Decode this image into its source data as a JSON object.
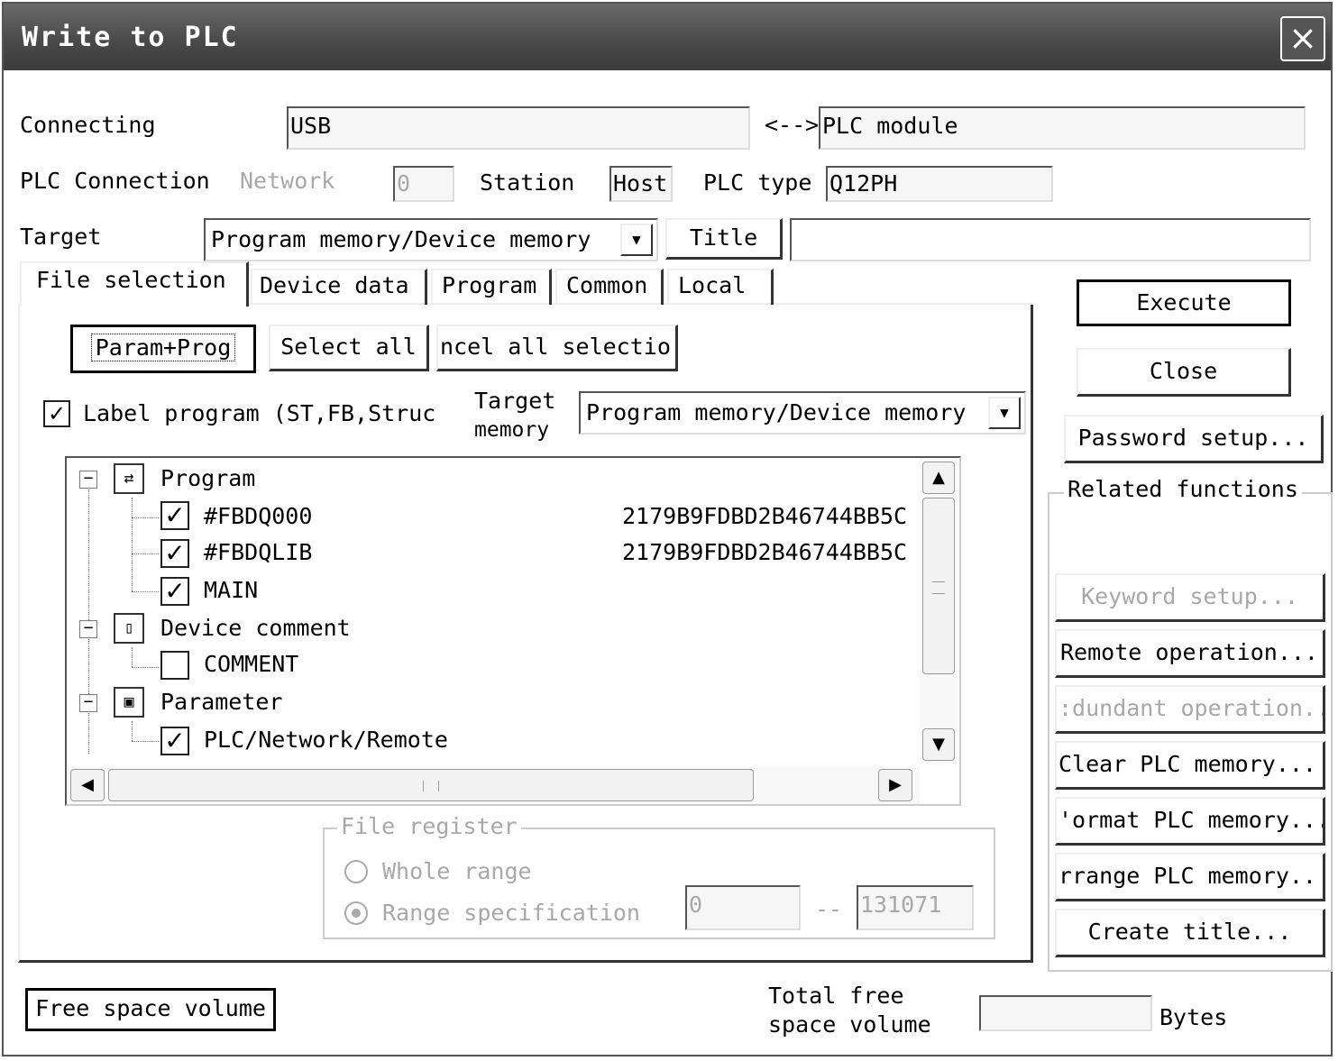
{
  "window": {
    "title": "Write to PLC",
    "close_glyph": "×"
  },
  "connection": {
    "connecting_label": "Connecting",
    "connecting_value": "USB",
    "arrow": "<-->",
    "module_value": "PLC module",
    "plc_connection_label": "PLC Connection",
    "network_label": "Network",
    "network_value": "0",
    "station_label": "Station",
    "station_value": "Host",
    "plc_type_label": "PLC type",
    "plc_type_value": "Q12PH"
  },
  "target": {
    "label": "Target",
    "selected": "Program memory/Device memory",
    "title_button": "Title",
    "title_value": ""
  },
  "tabs": [
    {
      "label": "File selection",
      "active": true
    },
    {
      "label": "Device data"
    },
    {
      "label": "Program"
    },
    {
      "label": "Common"
    },
    {
      "label": "Local"
    }
  ],
  "file_selection": {
    "param_prog_button": "Param+Prog",
    "select_all_button": "Select all",
    "cancel_all_button": "ncel all selectio",
    "label_program_checkbox": "Label program (ST,FB,Struc",
    "label_program_checked": true,
    "target_memory_label_1": "Target",
    "target_memory_label_2": "memory",
    "target_memory_selected": "Program memory/Device memory"
  },
  "tree": {
    "groups": [
      {
        "label": "Program",
        "icon": "program-icon",
        "expander": "−",
        "items": [
          {
            "label": "#FBDQ000",
            "checked": true,
            "hash": "2179B9FDBD2B46744BB5C"
          },
          {
            "label": "#FBDQLIB",
            "checked": true,
            "hash": "2179B9FDBD2B46744BB5C"
          },
          {
            "label": "MAIN",
            "checked": true,
            "hash": ""
          }
        ]
      },
      {
        "label": "Device comment",
        "icon": "device-comment-icon",
        "expander": "−",
        "items": [
          {
            "label": "COMMENT",
            "checked": false,
            "hash": ""
          }
        ]
      },
      {
        "label": "Parameter",
        "icon": "parameter-icon",
        "expander": "−",
        "items": [
          {
            "label": "PLC/Network/Remote",
            "checked": true,
            "hash": ""
          }
        ]
      }
    ]
  },
  "file_register": {
    "group_label": "File register",
    "whole_range": "Whole range",
    "range_spec": "Range specification",
    "range_from": "0",
    "range_sep": "--",
    "range_to": "131071",
    "selected": "range_spec"
  },
  "actions": {
    "execute": "Execute",
    "close": "Close",
    "password_setup": "Password setup...",
    "related_label": "Related functions",
    "keyword_setup": "Keyword setup...",
    "remote_operation": "Remote operation...",
    "redundant_operation": ":dundant operation...",
    "clear_memory": "Clear PLC memory...",
    "format_memory": "'ormat PLC memory...",
    "arrange_memory": "rrange PLC memory..",
    "create_title": "Create title..."
  },
  "footer": {
    "free_space_button": "Free space volume",
    "total_free_1": "Total free",
    "total_free_2": "space volume",
    "total_value": "",
    "bytes_label": "Bytes"
  },
  "glyphs": {
    "check": "✓",
    "dropdown": "▼",
    "up": "▲",
    "down": "▼",
    "left": "◀",
    "right": "▶"
  },
  "colors": {
    "titlebar": "#4a4a4a",
    "disabled_text": "#a8a8a8"
  }
}
